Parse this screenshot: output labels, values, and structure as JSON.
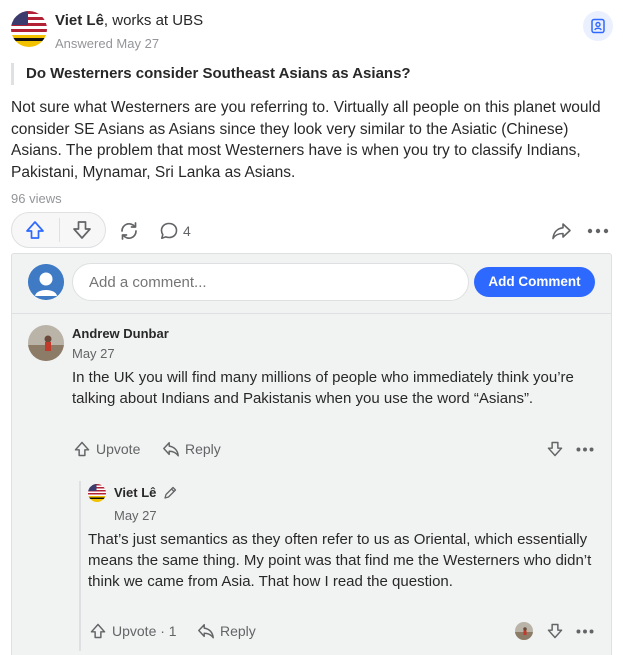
{
  "answer": {
    "author_name": "Viet Lê",
    "author_credential": ", works at UBS",
    "answered_date": "Answered May 27",
    "question": "Do Westerners consider Southeast Asians as Asians?",
    "body": "Not sure what Westerners are you referring to. Virtually all people on this planet would consider SE Asians as Asians since they look very similar to the Asiatic (Chinese) Asians. The problem that most Westerners have is when you try to classify Indians, Pakistani, Mynamar, Sri Lanka as Asians.",
    "views": "96 views"
  },
  "actions": {
    "comment_count": "4"
  },
  "comment_box": {
    "placeholder": "Add a comment...",
    "button_label": "Add Comment"
  },
  "comments": [
    {
      "author": "Andrew Dunbar",
      "date": "May 27",
      "text": "In the UK you will find many millions of people who immediately think you’re talking about Indians and Pakistanis when you use the word “Asians”.",
      "upvote_label": "Upvote",
      "reply_label": "Reply"
    },
    {
      "author": "Viet Lê",
      "date": "May 27",
      "text": "That’s just semantics as they often refer to us as Oriental, which essentially means the same thing. My point was that find me the Westerners who didn’t think we came from Asia. That how I read the question.",
      "upvote_label": "Upvote · 1",
      "reply_label": "Reply"
    }
  ],
  "colors": {
    "accent_blue": "#2e69ff",
    "panel_bg": "#f1f2f2",
    "text_primary": "#282829",
    "text_secondary": "#939598"
  },
  "icons": [
    "us-flag-icon",
    "save-bookmark-icon",
    "upvote-arrow-icon",
    "downvote-arrow-icon",
    "reshare-icon",
    "comment-bubble-icon",
    "share-arrow-icon",
    "more-dots-icon",
    "pencil-icon"
  ]
}
